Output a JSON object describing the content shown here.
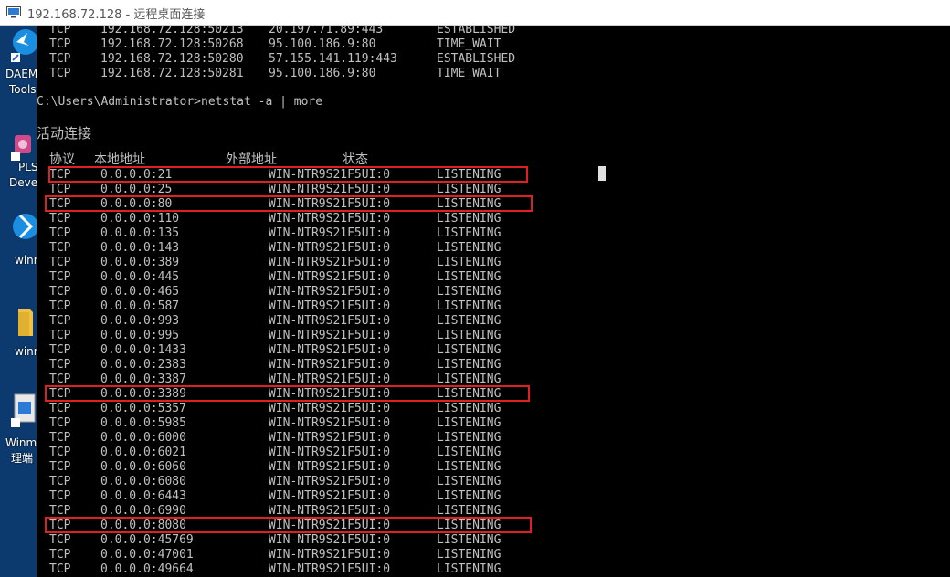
{
  "window": {
    "title": "192.168.72.128 - 远程桌面连接"
  },
  "desktop_icons": [
    {
      "label": "DAEM",
      "label2": "Tools"
    },
    {
      "label": "PLS",
      "label2": "Deve"
    },
    {
      "label": "winn",
      "label2": ""
    },
    {
      "label": "winn",
      "label2": ""
    },
    {
      "label": "Winm",
      "label2": "理端"
    }
  ],
  "console": {
    "prev_rows": [
      [
        "TCP",
        "192.168.72.128:50213",
        "20.197.71.89:443",
        "ESTABLISHED"
      ],
      [
        "TCP",
        "192.168.72.128:50268",
        "95.100.186.9:80",
        "TIME_WAIT"
      ],
      [
        "TCP",
        "192.168.72.128:50280",
        "57.155.141.119:443",
        "ESTABLISHED"
      ],
      [
        "TCP",
        "192.168.72.128:50281",
        "95.100.186.9:80",
        "TIME_WAIT"
      ]
    ],
    "prompt": "C:\\Users\\Administrator>netstat -a | more",
    "section_title": "活动连接",
    "headers": [
      "协议",
      "本地地址",
      "外部地址",
      "状态"
    ],
    "rows": [
      [
        "TCP",
        "0.0.0.0:21",
        "WIN-NTR9S21F5UI:0",
        "LISTENING"
      ],
      [
        "TCP",
        "0.0.0.0:25",
        "WIN-NTR9S21F5UI:0",
        "LISTENING"
      ],
      [
        "TCP",
        "0.0.0.0:80",
        "WIN-NTR9S21F5UI:0",
        "LISTENING"
      ],
      [
        "TCP",
        "0.0.0.0:110",
        "WIN-NTR9S21F5UI:0",
        "LISTENING"
      ],
      [
        "TCP",
        "0.0.0.0:135",
        "WIN-NTR9S21F5UI:0",
        "LISTENING"
      ],
      [
        "TCP",
        "0.0.0.0:143",
        "WIN-NTR9S21F5UI:0",
        "LISTENING"
      ],
      [
        "TCP",
        "0.0.0.0:389",
        "WIN-NTR9S21F5UI:0",
        "LISTENING"
      ],
      [
        "TCP",
        "0.0.0.0:445",
        "WIN-NTR9S21F5UI:0",
        "LISTENING"
      ],
      [
        "TCP",
        "0.0.0.0:465",
        "WIN-NTR9S21F5UI:0",
        "LISTENING"
      ],
      [
        "TCP",
        "0.0.0.0:587",
        "WIN-NTR9S21F5UI:0",
        "LISTENING"
      ],
      [
        "TCP",
        "0.0.0.0:993",
        "WIN-NTR9S21F5UI:0",
        "LISTENING"
      ],
      [
        "TCP",
        "0.0.0.0:995",
        "WIN-NTR9S21F5UI:0",
        "LISTENING"
      ],
      [
        "TCP",
        "0.0.0.0:1433",
        "WIN-NTR9S21F5UI:0",
        "LISTENING"
      ],
      [
        "TCP",
        "0.0.0.0:2383",
        "WIN-NTR9S21F5UI:0",
        "LISTENING"
      ],
      [
        "TCP",
        "0.0.0.0:3387",
        "WIN-NTR9S21F5UI:0",
        "LISTENING"
      ],
      [
        "TCP",
        "0.0.0.0:3389",
        "WIN-NTR9S21F5UI:0",
        "LISTENING"
      ],
      [
        "TCP",
        "0.0.0.0:5357",
        "WIN-NTR9S21F5UI:0",
        "LISTENING"
      ],
      [
        "TCP",
        "0.0.0.0:5985",
        "WIN-NTR9S21F5UI:0",
        "LISTENING"
      ],
      [
        "TCP",
        "0.0.0.0:6000",
        "WIN-NTR9S21F5UI:0",
        "LISTENING"
      ],
      [
        "TCP",
        "0.0.0.0:6021",
        "WIN-NTR9S21F5UI:0",
        "LISTENING"
      ],
      [
        "TCP",
        "0.0.0.0:6060",
        "WIN-NTR9S21F5UI:0",
        "LISTENING"
      ],
      [
        "TCP",
        "0.0.0.0:6080",
        "WIN-NTR9S21F5UI:0",
        "LISTENING"
      ],
      [
        "TCP",
        "0.0.0.0:6443",
        "WIN-NTR9S21F5UI:0",
        "LISTENING"
      ],
      [
        "TCP",
        "0.0.0.0:6990",
        "WIN-NTR9S21F5UI:0",
        "LISTENING"
      ],
      [
        "TCP",
        "0.0.0.0:8080",
        "WIN-NTR9S21F5UI:0",
        "LISTENING"
      ],
      [
        "TCP",
        "0.0.0.0:45769",
        "WIN-NTR9S21F5UI:0",
        "LISTENING"
      ],
      [
        "TCP",
        "0.0.0.0:47001",
        "WIN-NTR9S21F5UI:0",
        "LISTENING"
      ],
      [
        "TCP",
        "0.0.0.0:49664",
        "WIN-NTR9S21F5UI:0",
        "LISTENING"
      ]
    ],
    "highlighted_ports": [
      "0.0.0.0:21",
      "0.0.0.0:80",
      "0.0.0.0:3389",
      "0.0.0.0:8080"
    ],
    "colors": {
      "text": "#c0c0c0",
      "highlight": "#e02020",
      "background": "#000000"
    }
  }
}
